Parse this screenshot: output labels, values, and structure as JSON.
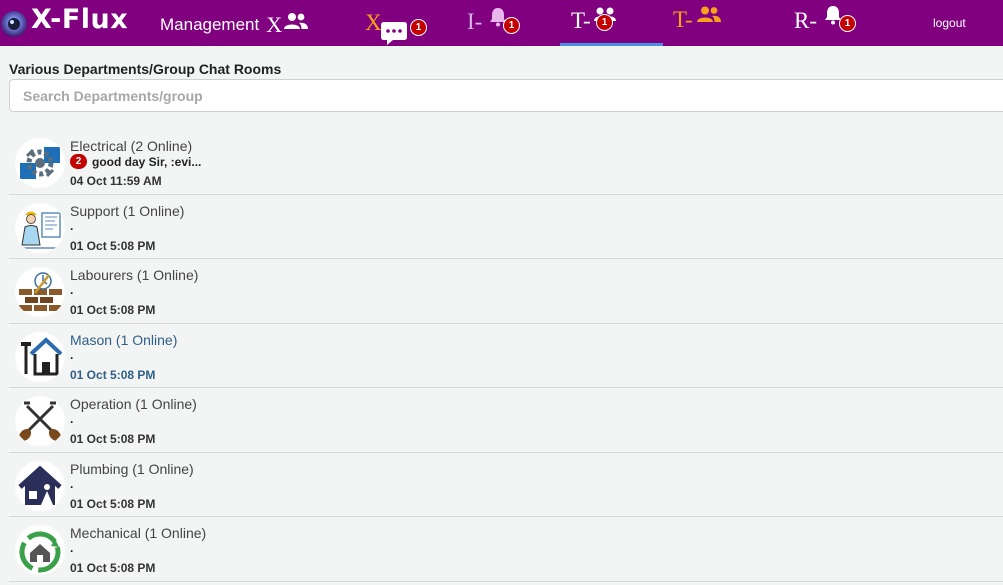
{
  "app": {
    "brand": "X-Flux"
  },
  "header": {
    "management_label": "Management",
    "management_icon_letter": "X",
    "tabs": [
      {
        "letter": "X",
        "icon": "chat-icon",
        "badge": "1",
        "letter_color": "#f7a21b"
      },
      {
        "letter": "I-",
        "icon": "bell-icon",
        "badge": "1",
        "letter_color": "#d7b5e3"
      },
      {
        "letter": "T-",
        "icon": "group-icon",
        "badge": "1",
        "letter_color": "#ffffff"
      },
      {
        "letter": "T-",
        "icon": "people-icon",
        "badge": "",
        "letter_color": "#f7a21b"
      },
      {
        "letter": "R-",
        "icon": "bell-icon",
        "badge": "1",
        "letter_color": "#ffffff"
      }
    ],
    "logout_label": "logout"
  },
  "main": {
    "section_title": "Various Departments/Group Chat Rooms",
    "search": {
      "placeholder": "Search Departments/group",
      "value": ""
    },
    "rooms": [
      {
        "name": "Electrical (2 Online)",
        "unread": "2",
        "last_message": "good day Sir, :evi...",
        "time": "04 Oct 11:59 AM",
        "icon": "electrical-gear-icon"
      },
      {
        "name": "Support (1 Online)",
        "unread": "",
        "last_message": ".",
        "time": "01 Oct 5:08 PM",
        "icon": "engineer-blueprint-icon"
      },
      {
        "name": "Labourers (1 Online)",
        "unread": "",
        "last_message": ".",
        "time": "01 Oct 5:08 PM",
        "icon": "brick-wall-icon"
      },
      {
        "name": "Mason (1 Online)",
        "unread": "",
        "last_message": ".",
        "time": "01 Oct 5:08 PM",
        "icon": "house-hammer-icon"
      },
      {
        "name": "Operation (1 Online)",
        "unread": "",
        "last_message": ".",
        "time": "01 Oct 5:08 PM",
        "icon": "crossed-shovels-icon"
      },
      {
        "name": "Plumbing (1 Online)",
        "unread": "",
        "last_message": ".",
        "time": "01 Oct 5:08 PM",
        "icon": "house-roof-icon"
      },
      {
        "name": "Mechanical (1 Online)",
        "unread": "",
        "last_message": ".",
        "time": "01 Oct 5:08 PM",
        "icon": "recycle-house-icon"
      }
    ]
  },
  "colors": {
    "topbar": "#800080",
    "accent_orange": "#f7a21b",
    "badge_red": "#c40000",
    "active_underline": "#4a90e2",
    "link_blue": "#2f5f86"
  }
}
